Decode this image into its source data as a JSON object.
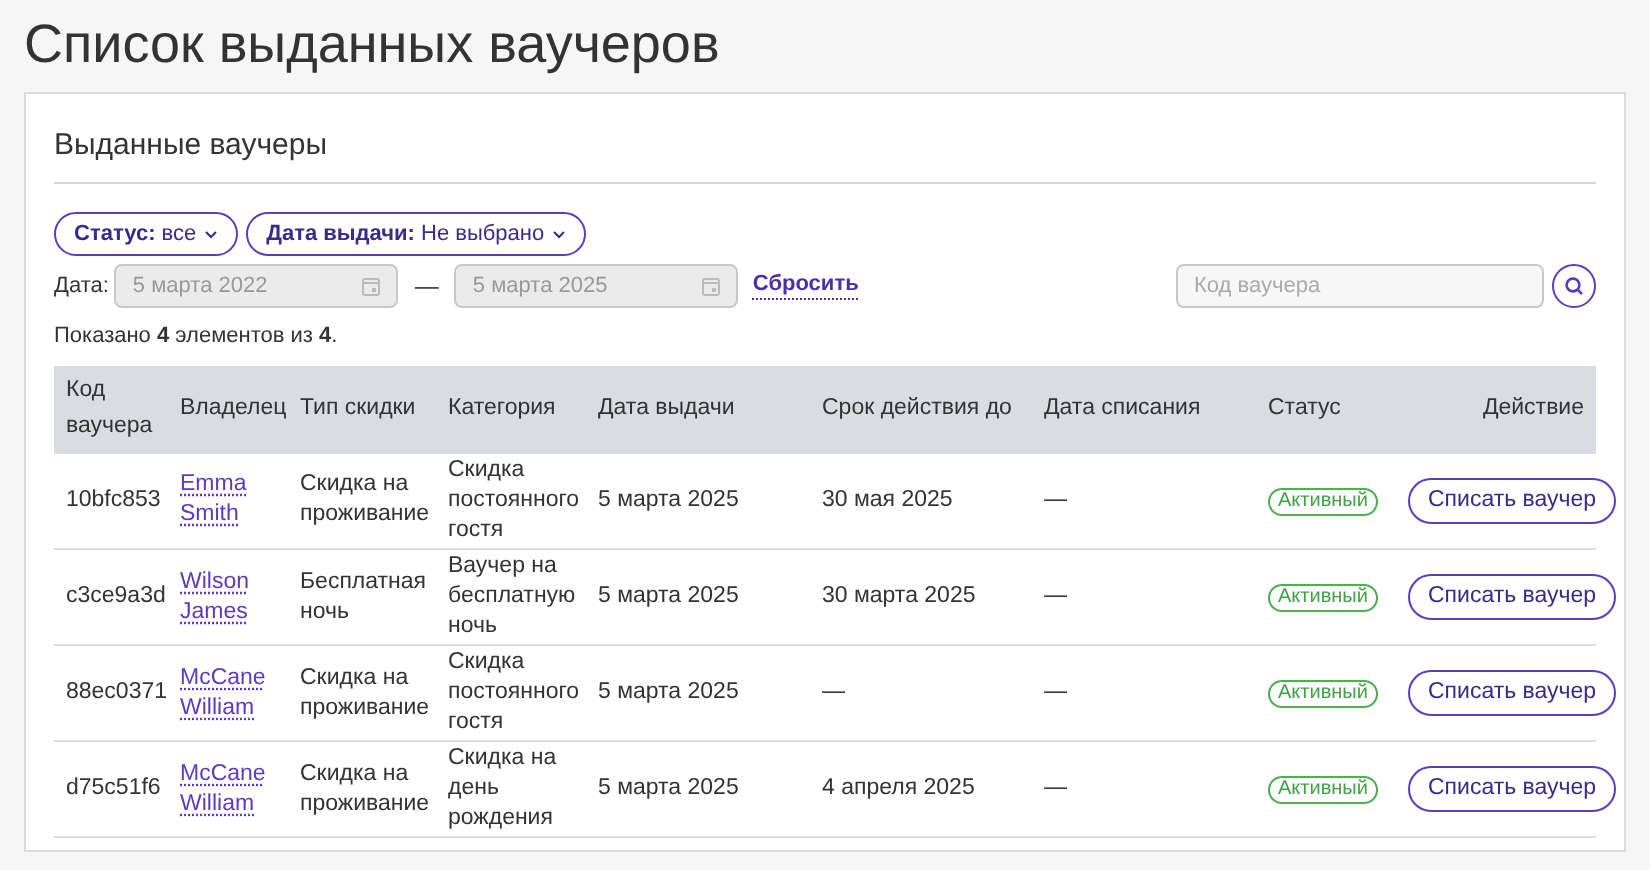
{
  "page_title": "Список выданных ваучеров",
  "card_title": "Выданные ваучеры",
  "filters": [
    {
      "label": "**Статус:** все"
    },
    {
      "label": "**Дата выдачи:** Не выбрано"
    }
  ],
  "date_range": {
    "label": "Дата:",
    "from": {
      "value": "5 марта 2022",
      "disabled": true
    },
    "separator": "—",
    "to": {
      "value": "5 марта 2025",
      "disabled": true
    },
    "reset": "Сбросить"
  },
  "search": {
    "placeholder": "Код ваучера"
  },
  "summary": "Показано **4** элементов из **4**.",
  "table": {
    "columns": [
      "Код ваучера",
      "Владелец",
      "Тип скидки",
      "Категория",
      "Дата выдачи",
      "Срок действия до",
      "Дата списания",
      "Статус",
      "Действие"
    ],
    "rows": [
      {
        "code": "10bfc853",
        "owner": "Emma Smith",
        "type": "Скидка на проживание",
        "category": "Скидка постоянного гостя",
        "issued": "5 марта 2025",
        "valid_until": "30 мая 2025",
        "written_off": "—",
        "status": "Активный",
        "action": "Списать ваучер"
      },
      {
        "code": "c3ce9a3d",
        "owner": "Wilson James",
        "type": "Бесплатная ночь",
        "category": "Ваучер на бесплатную ночь",
        "issued": "5 марта 2025",
        "valid_until": "30 марта 2025",
        "written_off": "—",
        "status": "Активный",
        "action": "Списать ваучер"
      },
      {
        "code": "88ec0371",
        "owner": "McCane William",
        "type": "Скидка на проживание",
        "category": "Скидка постоянного гостя",
        "issued": "5 марта 2025",
        "valid_until": "—",
        "written_off": "—",
        "status": "Активный",
        "action": "Списать ваучер"
      },
      {
        "code": "d75c51f6",
        "owner": "McCane William",
        "type": "Скидка на проживание",
        "category": "Скидка на день рождения",
        "issued": "5 марта 2025",
        "valid_until": "4 апреля 2025",
        "written_off": "—",
        "status": "Активный",
        "action": "Списать ваучер"
      }
    ]
  }
}
